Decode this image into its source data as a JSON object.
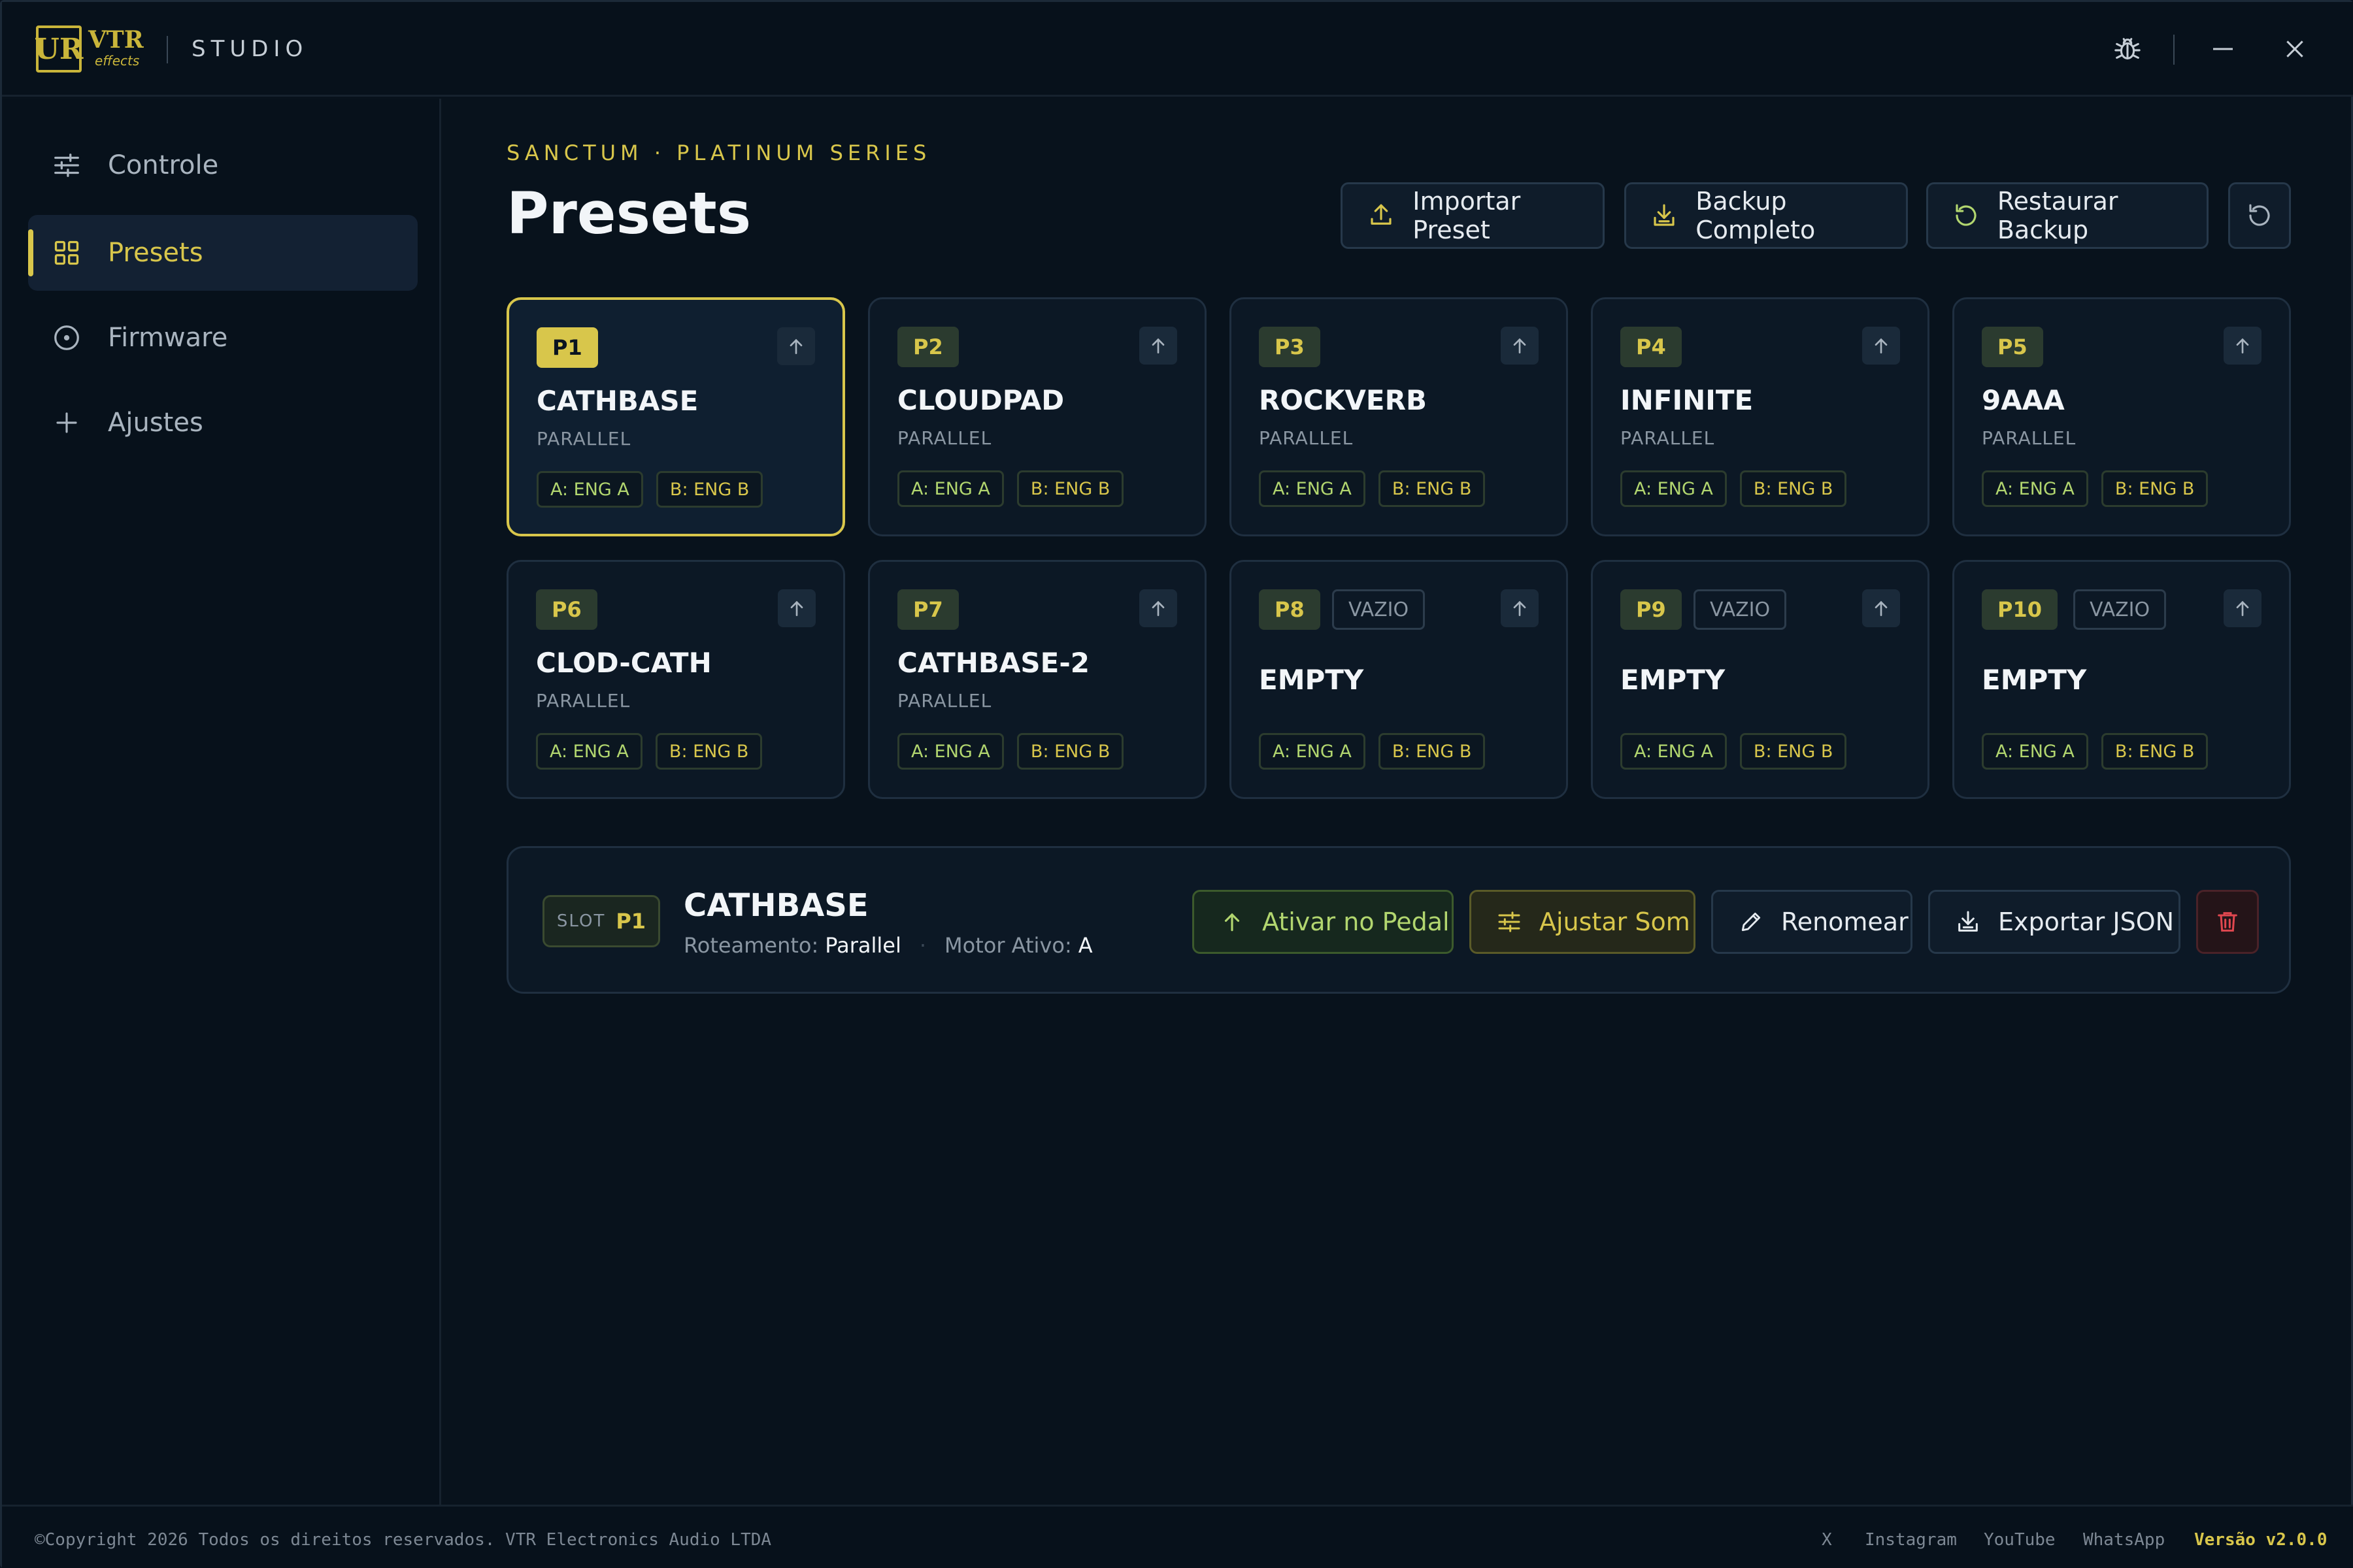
{
  "titlebar": {
    "logo_mark": "UR",
    "logo_text": "VTR",
    "logo_sub": "effects",
    "app_name": "STUDIO"
  },
  "sidebar": {
    "items": [
      {
        "label": "Controle",
        "icon": "sliders-icon"
      },
      {
        "label": "Presets",
        "icon": "grid-icon",
        "active": true
      },
      {
        "label": "Firmware",
        "icon": "target-icon"
      },
      {
        "label": "Ajustes",
        "icon": "plus-icon"
      }
    ]
  },
  "header": {
    "eyebrow": "SANCTUM · PLATINUM SERIES",
    "title": "Presets",
    "buttons": {
      "import": "Importar Preset",
      "backup": "Backup Completo",
      "restore": "Restaurar Backup"
    }
  },
  "presets": [
    {
      "slot": "P1",
      "name": "CATHBASE",
      "routing": "PARALLEL",
      "eng_a": "A: ENG A",
      "eng_b": "B: ENG B",
      "selected": true
    },
    {
      "slot": "P2",
      "name": "CLOUDPAD",
      "routing": "PARALLEL",
      "eng_a": "A: ENG A",
      "eng_b": "B: ENG B"
    },
    {
      "slot": "P3",
      "name": "ROCKVERB",
      "routing": "PARALLEL",
      "eng_a": "A: ENG A",
      "eng_b": "B: ENG B"
    },
    {
      "slot": "P4",
      "name": "INFINITE",
      "routing": "PARALLEL",
      "eng_a": "A: ENG A",
      "eng_b": "B: ENG B"
    },
    {
      "slot": "P5",
      "name": "9AAA",
      "routing": "PARALLEL",
      "eng_a": "A: ENG A",
      "eng_b": "B: ENG B"
    },
    {
      "slot": "P6",
      "name": "CLOD-CATH",
      "routing": "PARALLEL",
      "eng_a": "A: ENG A",
      "eng_b": "B: ENG B"
    },
    {
      "slot": "P7",
      "name": "CATHBASE-2",
      "routing": "PARALLEL",
      "eng_a": "A: ENG A",
      "eng_b": "B: ENG B"
    },
    {
      "slot": "P8",
      "name": "EMPTY",
      "empty_tag": "VAZIO",
      "eng_a": "A: ENG A",
      "eng_b": "B: ENG B"
    },
    {
      "slot": "P9",
      "name": "EMPTY",
      "empty_tag": "VAZIO",
      "eng_a": "A: ENG A",
      "eng_b": "B: ENG B"
    },
    {
      "slot": "P10",
      "name": "EMPTY",
      "empty_tag": "VAZIO",
      "eng_a": "A: ENG A",
      "eng_b": "B: ENG B"
    }
  ],
  "detail": {
    "slot_label": "SLOT",
    "slot_value": "P1",
    "name": "CATHBASE",
    "routing_label": "Roteamento:",
    "routing_value": "Parallel",
    "motor_label": "Motor Ativo:",
    "motor_value": "A",
    "buttons": {
      "activate": "Ativar no Pedal",
      "adjust": "Ajustar Som",
      "rename": "Renomear",
      "export": "Exportar JSON"
    }
  },
  "footer": {
    "copyright": "©Copyright 2026 Todos os direitos reservados. VTR Electronics Audio LTDA",
    "links": [
      "X",
      "Instagram",
      "YouTube",
      "WhatsApp"
    ],
    "version": "Versão v2.0.0"
  },
  "colors": {
    "accent": "#d8c64b",
    "engine_a": "#b2d66f",
    "background": "#08121c",
    "danger": "#e0474f"
  }
}
